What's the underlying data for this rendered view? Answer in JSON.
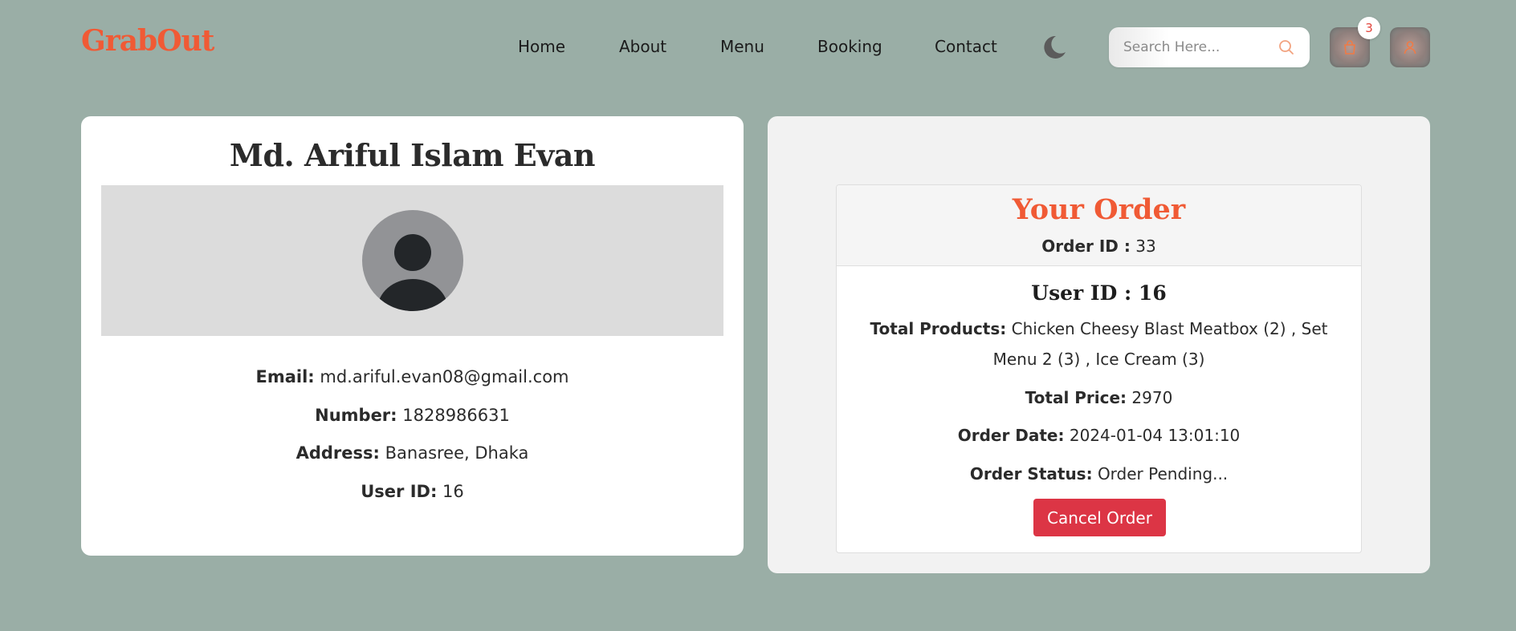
{
  "brand": {
    "logo": "GrabOut",
    "accent": "#f05a35"
  },
  "nav": {
    "items": [
      {
        "label": "Home"
      },
      {
        "label": "About"
      },
      {
        "label": "Menu"
      },
      {
        "label": "Booking"
      },
      {
        "label": "Contact"
      }
    ]
  },
  "header": {
    "theme_toggle_icon": "moon-icon",
    "search": {
      "placeholder": "Search Here...",
      "value": "",
      "icon": "search-icon"
    },
    "cart": {
      "icon": "bag-icon",
      "count": "3"
    },
    "account": {
      "icon": "user-icon"
    }
  },
  "profile": {
    "name": "Md. Ariful Islam Evan",
    "avatar_icon": "avatar-placeholder",
    "email_label": "Email:",
    "email": "md.ariful.evan08@gmail.com",
    "number_label": "Number:",
    "number": "1828986631",
    "address_label": "Address:",
    "address": "Banasree, Dhaka",
    "user_id_label": "User ID:",
    "user_id": "16"
  },
  "order": {
    "title": "Your Order",
    "order_id_label": "Order ID :",
    "order_id": "33",
    "user_id_heading": "User ID : 16",
    "total_products_label": "Total Products:",
    "total_products": "Chicken Cheesy Blast Meatbox (2) , Set Menu 2 (3) , Ice Cream (3)",
    "total_price_label": "Total Price:",
    "total_price": "2970",
    "order_date_label": "Order Date:",
    "order_date": "2024-01-04 13:01:10",
    "order_status_label": "Order Status:",
    "order_status": "Order Pending...",
    "cancel_label": "Cancel Order",
    "cancel_color": "#dc3545"
  }
}
